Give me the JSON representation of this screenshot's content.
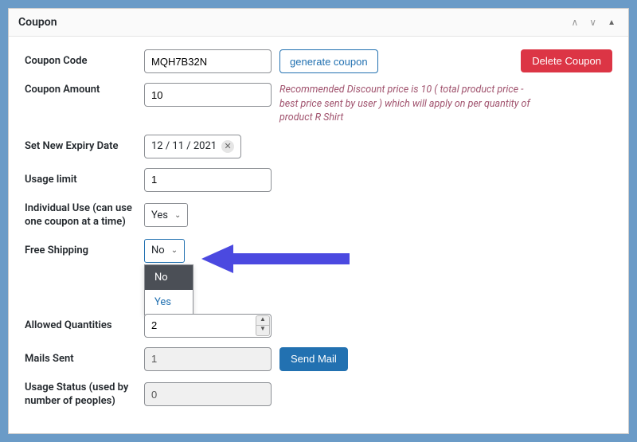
{
  "panel": {
    "title": "Coupon"
  },
  "buttons": {
    "delete": "Delete Coupon",
    "generate": "generate coupon",
    "sendmail": "Send Mail"
  },
  "fields": {
    "code": {
      "label": "Coupon Code",
      "value": "MQH7B32N"
    },
    "amount": {
      "label": "Coupon Amount",
      "value": "10"
    },
    "hint": "Recommended Discount price is 10 ( total product price - best price sent by user ) which will apply on per quantity of product R Shirt",
    "expiry": {
      "label": "Set New Expiry Date",
      "value": "12 / 11 / 2021"
    },
    "usage_limit": {
      "label": "Usage limit",
      "value": "1"
    },
    "individual": {
      "label": "Individual Use (can use one coupon at a time)",
      "value": "Yes"
    },
    "free_shipping": {
      "label": "Free Shipping",
      "value": "No",
      "options": [
        "No",
        "Yes"
      ],
      "selected_index": 0
    },
    "allowed_qty": {
      "label": "Allowed Quantities",
      "value": "2"
    },
    "mails_sent": {
      "label": "Mails Sent",
      "value": "1"
    },
    "usage_status": {
      "label": "Usage Status (used by number of peoples)",
      "value": "0"
    }
  }
}
